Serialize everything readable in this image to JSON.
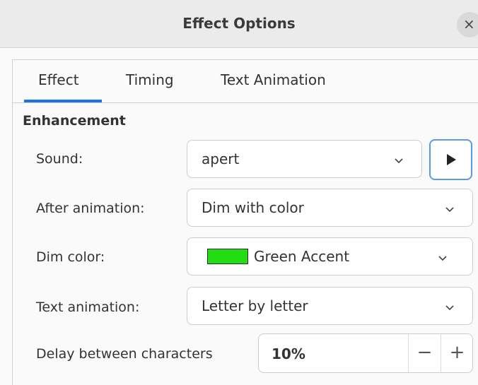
{
  "window": {
    "title": "Effect Options",
    "close_glyph": "×"
  },
  "tabs": [
    {
      "label": "Effect",
      "active": true
    },
    {
      "label": "Timing",
      "active": false
    },
    {
      "label": "Text Animation",
      "active": false
    }
  ],
  "section": {
    "title": "Enhancement"
  },
  "sound": {
    "label": "Sound:",
    "value": "apert"
  },
  "after_animation": {
    "label": "After animation:",
    "value": "Dim with color"
  },
  "dim_color": {
    "label": "Dim color:",
    "value": "Green Accent",
    "swatch": "#22dd11"
  },
  "text_animation": {
    "label": "Text animation:",
    "value": "Letter by letter"
  },
  "delay": {
    "label": "Delay between characters",
    "value": "10%",
    "minus": "−",
    "plus": "+"
  },
  "colors": {
    "accent": "#1a73e8",
    "play_focus": "#5a9be6"
  },
  "icons": [
    "close-icon",
    "chevron-down-icon",
    "play-icon",
    "minus-icon",
    "plus-icon"
  ]
}
